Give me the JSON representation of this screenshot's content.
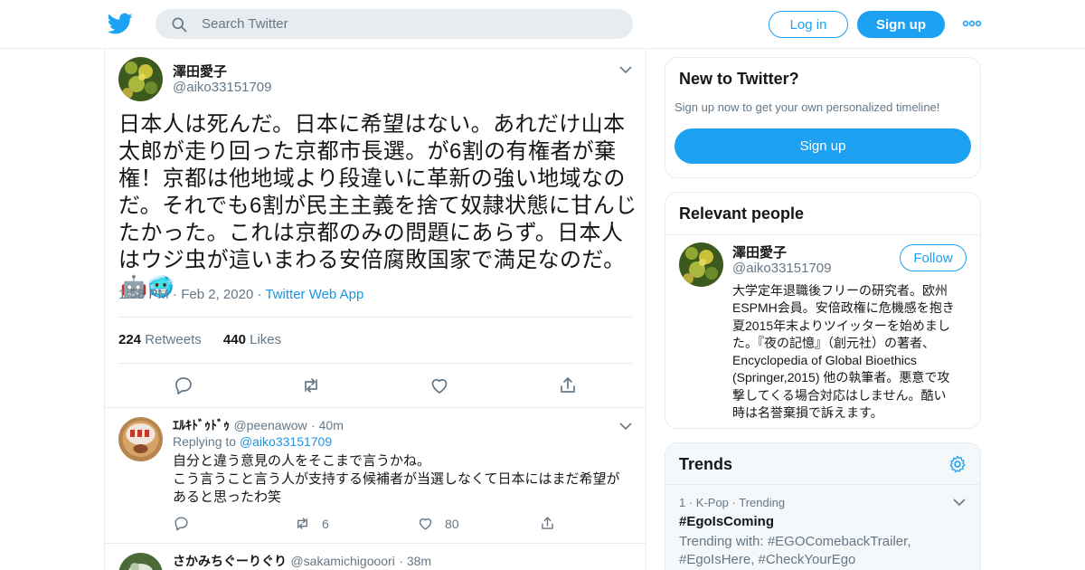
{
  "header": {
    "search_placeholder": "Search Twitter",
    "login_label": "Log in",
    "signup_label": "Sign up"
  },
  "main_tweet": {
    "name": "澤田愛子",
    "handle": "@aiko33151709",
    "text": "日本人は死んだ。日本に希望はない。あれだけ山本太郎が走り回った京都市長選。が6割の有権者が棄権！京都は他地域より段違いに革新の強い地域なのだ。それでも6割が民主主義を捨て奴隷状態に甘んじたかった。これは京都のみの問題にあらず。日本人はウジ虫が這いまわる安倍腐敗国家で満足なのだ。",
    "emoji_text": "🤖🥶",
    "time": "1:58 PM",
    "date": "Feb 2, 2020",
    "source": "Twitter Web App",
    "retweet_count": "224",
    "retweet_label": "Retweets",
    "like_count": "440",
    "like_label": "Likes"
  },
  "replies": [
    {
      "name": "ｴﾙｷﾄﾞｩﾄﾞｩ",
      "handle": "@peenawow",
      "time": "40m",
      "replying_prefix": "Replying to",
      "replying_to": "@aiko33151709",
      "text_line1": "自分と違う意見の人をそこまで言うかね。",
      "text_line2": "こう言うこと言う人が支持する候補者が当選しなくて日本にはまだ希望が",
      "text_line3": "あると思ったわ笑",
      "retweets": "6",
      "likes": "80"
    },
    {
      "name": "さかみちぐーりぐり",
      "handle": "@sakamichigooori",
      "time": "38m"
    }
  ],
  "new_to_twitter": {
    "title": "New to Twitter?",
    "subtitle": "Sign up now to get your own personalized timeline!",
    "button": "Sign up"
  },
  "relevant_people": {
    "title": "Relevant people",
    "name": "澤田愛子",
    "handle": "@aiko33151709",
    "follow_label": "Follow",
    "bio_lines": [
      "大学定年退職後フリーの研究者。欧州",
      "ESPMH会員。安倍政権に危機感を抱き",
      "夏2015年末よりツイッターを始めまし",
      "た。『夜の記憶』（創元社）の著者、",
      "Encyclopedia of Global Bioethics",
      "(Springer,2015) 他の執筆者。悪意で攻",
      "撃してくる場合対応はしません。酷い",
      "時は名誉棄損で訴えます。"
    ]
  },
  "trends": {
    "title": "Trends",
    "item_meta": "1 · K-Pop · Trending",
    "item_name": "#EgoIsComing",
    "item_desc_line1": "Trending with: #EGOComebackTrailer,",
    "item_desc_line2": "#EgoIsHere, #CheckYourEgo"
  },
  "colors": {
    "accent": "#1da1f2",
    "border": "#e6ecf0",
    "muted": "#657786"
  }
}
